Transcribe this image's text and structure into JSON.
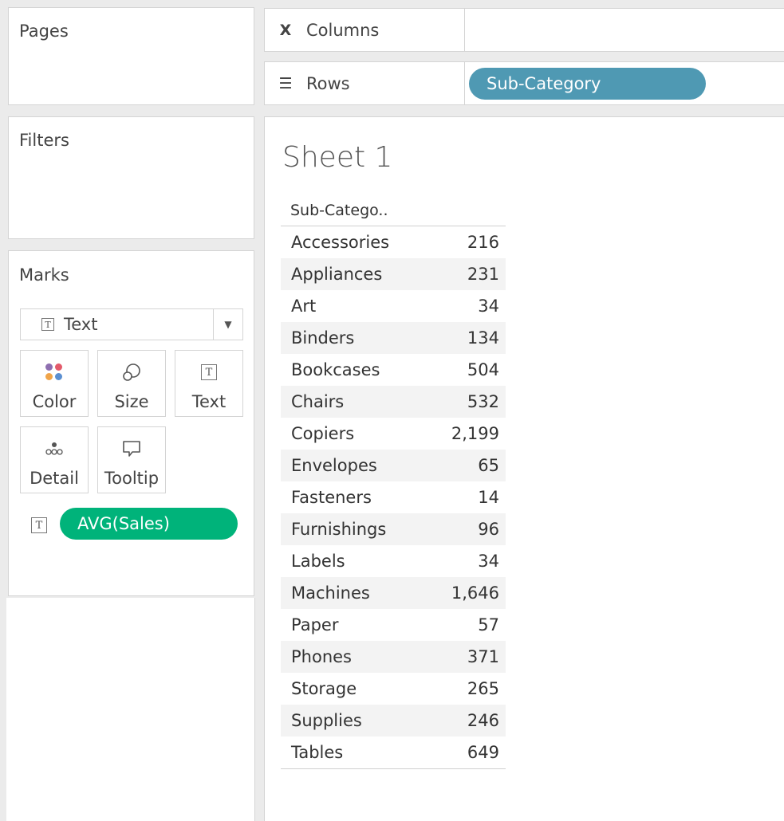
{
  "pages": {
    "title": "Pages"
  },
  "filters": {
    "title": "Filters"
  },
  "marks": {
    "title": "Marks",
    "mark_type": "Text",
    "buttons": {
      "color": "Color",
      "size": "Size",
      "text": "Text",
      "detail": "Detail",
      "tooltip": "Tooltip"
    },
    "field_pill": "AVG(Sales)"
  },
  "shelves": {
    "columns_label": "Columns",
    "rows_label": "Rows",
    "rows_pill": "Sub-Category"
  },
  "view": {
    "sheet_title": "Sheet 1",
    "column_header": "Sub-Catego..",
    "rows": [
      {
        "category": "Accessories",
        "value": "216"
      },
      {
        "category": "Appliances",
        "value": "231"
      },
      {
        "category": "Art",
        "value": "34"
      },
      {
        "category": "Binders",
        "value": "134"
      },
      {
        "category": "Bookcases",
        "value": "504"
      },
      {
        "category": "Chairs",
        "value": "532"
      },
      {
        "category": "Copiers",
        "value": "2,199"
      },
      {
        "category": "Envelopes",
        "value": "65"
      },
      {
        "category": "Fasteners",
        "value": "14"
      },
      {
        "category": "Furnishings",
        "value": "96"
      },
      {
        "category": "Labels",
        "value": "34"
      },
      {
        "category": "Machines",
        "value": "1,646"
      },
      {
        "category": "Paper",
        "value": "57"
      },
      {
        "category": "Phones",
        "value": "371"
      },
      {
        "category": "Storage",
        "value": "265"
      },
      {
        "category": "Supplies",
        "value": "246"
      },
      {
        "category": "Tables",
        "value": "649"
      }
    ]
  },
  "colors": {
    "dimension_pill": "#4f99b3",
    "measure_pill": "#00b37a"
  }
}
